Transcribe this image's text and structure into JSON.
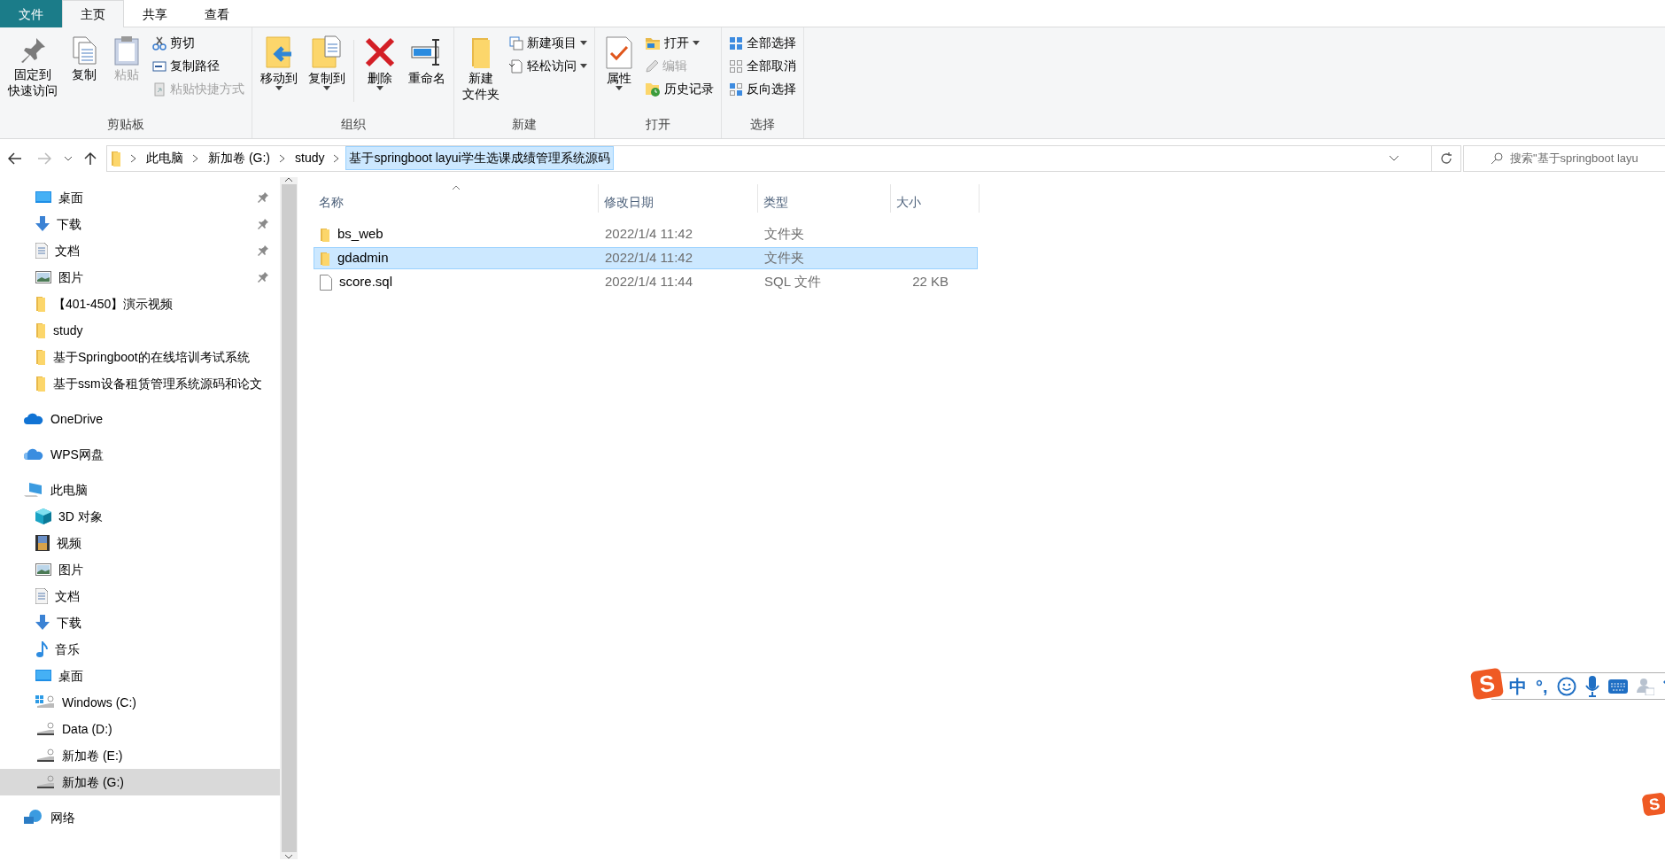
{
  "ribbon": {
    "tabs": [
      {
        "label": "文件",
        "kind": "file",
        "selected": false
      },
      {
        "label": "主页",
        "kind": "tab",
        "selected": true
      },
      {
        "label": "共享",
        "kind": "tab",
        "selected": false
      },
      {
        "label": "查看",
        "kind": "tab",
        "selected": false
      }
    ],
    "groups": [
      {
        "label": "剪贴板",
        "items": [
          {
            "kind": "large",
            "lines": [
              "固定到",
              "快速访问"
            ],
            "disabled": false,
            "dropdown": false
          },
          {
            "kind": "large",
            "label": "复制",
            "disabled": false,
            "dropdown": false
          },
          {
            "kind": "large",
            "label": "粘贴",
            "disabled": true,
            "dropdown": false
          },
          {
            "kind": "stack",
            "items": [
              {
                "label": "剪切",
                "disabled": false,
                "dropdown": false
              },
              {
                "label": "复制路径",
                "disabled": false,
                "dropdown": false
              },
              {
                "label": "粘贴快捷方式",
                "disabled": true,
                "dropdown": false
              }
            ]
          }
        ]
      },
      {
        "label": "组织",
        "items": [
          {
            "kind": "large",
            "label": "移动到",
            "disabled": false,
            "dropdown": true
          },
          {
            "kind": "large",
            "label": "复制到",
            "disabled": false,
            "dropdown": true
          },
          {
            "kind": "separator"
          },
          {
            "kind": "large",
            "label": "删除",
            "disabled": false,
            "dropdown": true
          },
          {
            "kind": "large",
            "label": "重命名",
            "disabled": false,
            "dropdown": false
          }
        ]
      },
      {
        "label": "新建",
        "items": [
          {
            "kind": "large",
            "lines": [
              "新建",
              "文件夹"
            ],
            "disabled": false,
            "dropdown": false
          },
          {
            "kind": "stack",
            "items": [
              {
                "label": "新建项目",
                "disabled": false,
                "dropdown": true
              },
              {
                "label": "轻松访问",
                "disabled": false,
                "dropdown": true
              }
            ]
          }
        ]
      },
      {
        "label": "打开",
        "items": [
          {
            "kind": "large",
            "label": "属性",
            "disabled": false,
            "dropdown": true
          },
          {
            "kind": "stack",
            "items": [
              {
                "label": "打开",
                "disabled": false,
                "dropdown": true
              },
              {
                "label": "编辑",
                "disabled": true,
                "dropdown": false
              },
              {
                "label": "历史记录",
                "disabled": false,
                "dropdown": false
              }
            ]
          }
        ]
      },
      {
        "label": "选择",
        "items": [
          {
            "kind": "stack",
            "items": [
              {
                "label": "全部选择",
                "disabled": false,
                "dropdown": false
              },
              {
                "label": "全部取消",
                "disabled": false,
                "dropdown": false
              },
              {
                "label": "反向选择",
                "disabled": false,
                "dropdown": false
              }
            ]
          }
        ]
      }
    ]
  },
  "address": {
    "segments": [
      {
        "label": "此电脑",
        "selected": false
      },
      {
        "label": "新加卷 (G:)",
        "selected": false
      },
      {
        "label": "study",
        "selected": false
      },
      {
        "label": "基于springboot layui学生选课成绩管理系统源码",
        "selected": true
      }
    ],
    "search_placeholder": "搜索\"基于springboot layu"
  },
  "sidebar": {
    "sections": [
      {
        "children": [
          {
            "label": "桌面",
            "pinned": true,
            "selected": false
          },
          {
            "label": "下载",
            "pinned": true,
            "selected": false
          },
          {
            "label": "文档",
            "pinned": true,
            "selected": false
          },
          {
            "label": "图片",
            "pinned": true,
            "selected": false
          },
          {
            "label": "【401-450】演示视频",
            "pinned": false,
            "selected": false
          },
          {
            "label": "study",
            "pinned": false,
            "selected": false
          },
          {
            "label": "基于Springboot的在线培训考试系统",
            "pinned": false,
            "selected": false
          },
          {
            "label": "基于ssm设备租赁管理系统源码和论文",
            "pinned": false,
            "selected": false
          }
        ]
      },
      {
        "label": "OneDrive",
        "selected": false
      },
      {
        "label": "WPS网盘",
        "selected": false
      },
      {
        "label": "此电脑",
        "selected": false,
        "children": [
          {
            "label": "3D 对象",
            "selected": false
          },
          {
            "label": "视频",
            "selected": false
          },
          {
            "label": "图片",
            "selected": false
          },
          {
            "label": "文档",
            "selected": false
          },
          {
            "label": "下载",
            "selected": false
          },
          {
            "label": "音乐",
            "selected": false
          },
          {
            "label": "桌面",
            "selected": false
          },
          {
            "label": "Windows (C:)",
            "selected": false
          },
          {
            "label": "Data (D:)",
            "selected": false
          },
          {
            "label": "新加卷 (E:)",
            "selected": false
          },
          {
            "label": "新加卷 (G:)",
            "selected": true
          }
        ]
      },
      {
        "label": "网络",
        "selected": false
      }
    ]
  },
  "files": {
    "columns": [
      {
        "label": "名称",
        "sorted": true
      },
      {
        "label": "修改日期",
        "sorted": false
      },
      {
        "label": "类型",
        "sorted": false
      },
      {
        "label": "大小",
        "sorted": false
      }
    ],
    "rows": [
      {
        "kind": "folder",
        "name": "bs_web",
        "date": "2022/1/4 11:42",
        "type": "文件夹",
        "selected": false
      },
      {
        "kind": "folder",
        "name": "gdadmin",
        "date": "2022/1/4 11:42",
        "type": "文件夹",
        "selected": true
      },
      {
        "kind": "file",
        "name": "score.sql",
        "date": "2022/1/4 11:44",
        "type": "SQL 文件",
        "size": "22 KB",
        "selected": false
      }
    ]
  },
  "ime": {
    "logo": "S",
    "mode": "中",
    "punctuation": "°,"
  },
  "corner_badge": {
    "logo": "S"
  }
}
